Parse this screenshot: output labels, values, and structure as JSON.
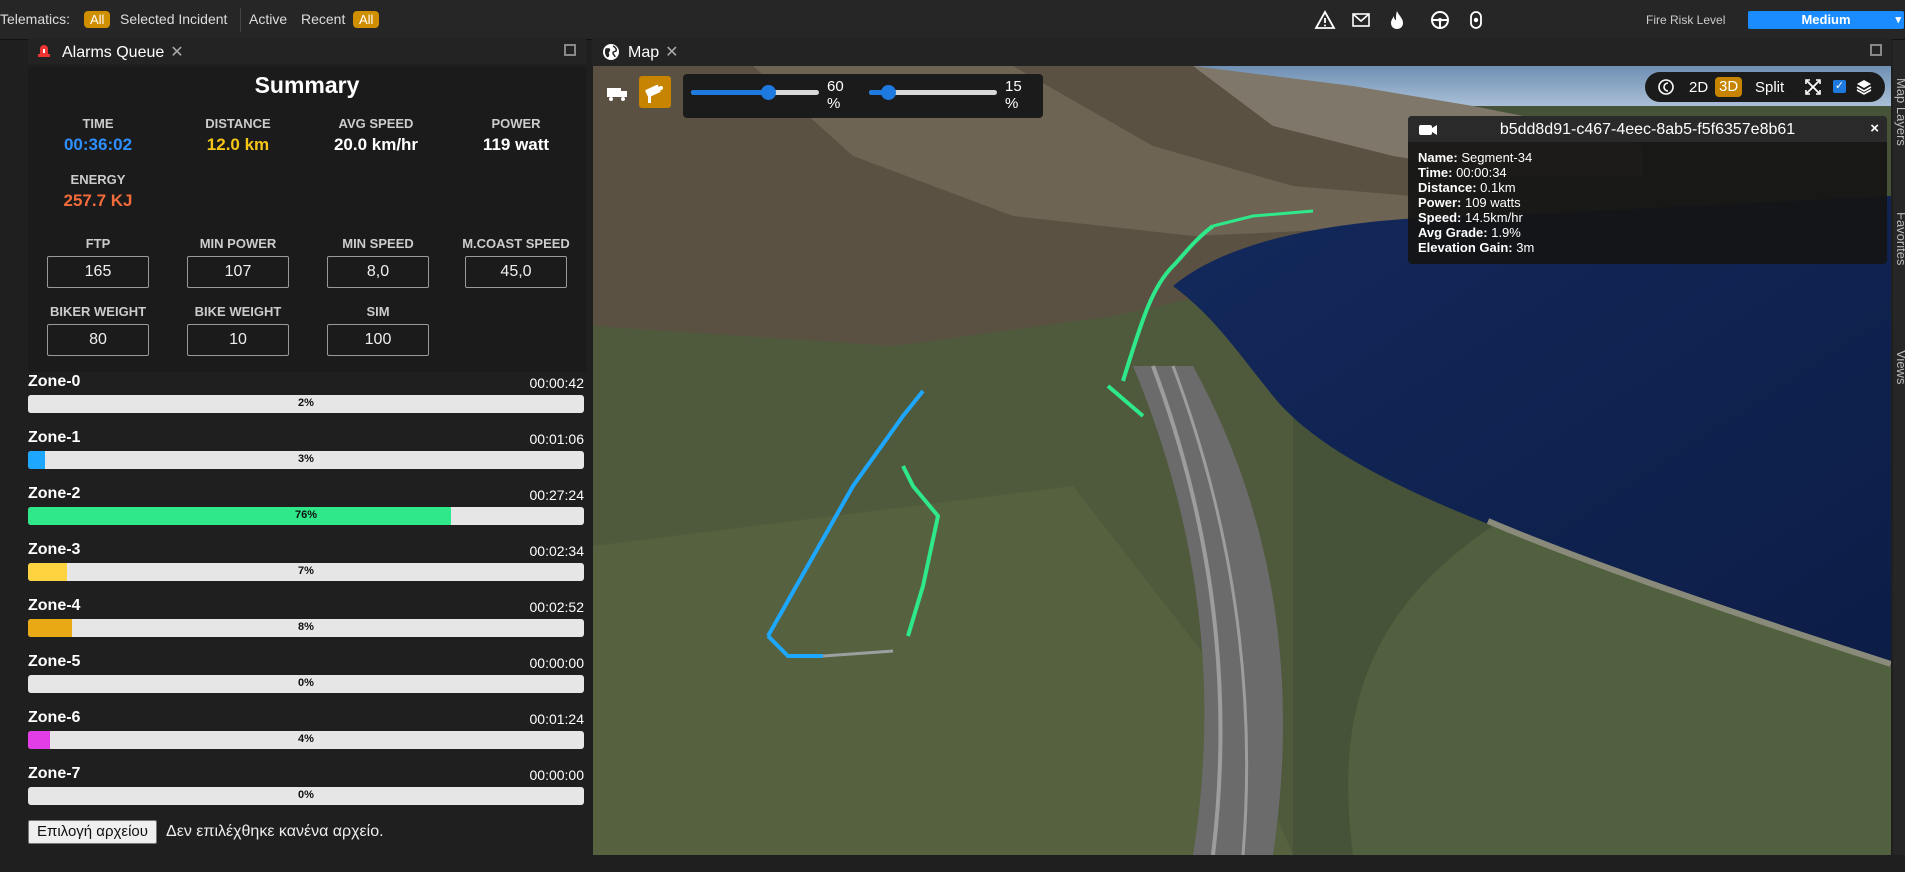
{
  "topbar": {
    "telematics_label": "Telematics:",
    "all_1": "All",
    "selected_incident": "Selected Incident",
    "active": "Active",
    "recent": "Recent",
    "all_2": "All",
    "icons": [
      "warning-icon",
      "mail-icon",
      "fire-icon",
      "steering-wheel-icon",
      "sensor-icon"
    ],
    "fire_risk_label": "Fire Risk Level",
    "fire_risk_value": "Medium"
  },
  "alarms_tab": {
    "label": "Alarms Queue"
  },
  "summary": {
    "title": "Summary",
    "stats": [
      {
        "label": "TIME",
        "value": "00:36:02",
        "color": "#2e8fff"
      },
      {
        "label": "DISTANCE",
        "value": "12.0 km",
        "color": "#f5c518"
      },
      {
        "label": "AVG SPEED",
        "value": "20.0 km/hr",
        "color": "#ffffff"
      },
      {
        "label": "POWER",
        "value": "119 watt",
        "color": "#ffffff"
      },
      {
        "label": "ENERGY",
        "value": "257.7 KJ",
        "color": "#f26b3a"
      }
    ],
    "params": [
      {
        "label": "FTP",
        "value": "165"
      },
      {
        "label": "MIN POWER",
        "value": "107"
      },
      {
        "label": "MIN SPEED",
        "value": "8,0"
      },
      {
        "label": "M.COAST SPEED",
        "value": "45,0"
      },
      {
        "label": "BIKER WEIGHT",
        "value": "80"
      },
      {
        "label": "BIKE WEIGHT",
        "value": "10"
      },
      {
        "label": "SIM",
        "value": "100"
      }
    ]
  },
  "zones": [
    {
      "name": "Zone-0",
      "time": "00:00:42",
      "percent": 2,
      "label": "2%",
      "color": "#e6e6e6"
    },
    {
      "name": "Zone-1",
      "time": "00:01:06",
      "percent": 3,
      "label": "3%",
      "color": "#1ea7ff"
    },
    {
      "name": "Zone-2",
      "time": "00:27:24",
      "percent": 76,
      "label": "76%",
      "color": "#2ee88a"
    },
    {
      "name": "Zone-3",
      "time": "00:02:34",
      "percent": 7,
      "label": "7%",
      "color": "#ffd23f"
    },
    {
      "name": "Zone-4",
      "time": "00:02:52",
      "percent": 8,
      "label": "8%",
      "color": "#e8a915"
    },
    {
      "name": "Zone-5",
      "time": "00:00:00",
      "percent": 0,
      "label": "0%",
      "color": "#e6e6e6"
    },
    {
      "name": "Zone-6",
      "time": "00:01:24",
      "percent": 4,
      "label": "4%",
      "color": "#e33de8"
    },
    {
      "name": "Zone-7",
      "time": "00:00:00",
      "percent": 0,
      "label": "0%",
      "color": "#e6e6e6"
    }
  ],
  "file_input": {
    "button": "Επιλογή αρχείου",
    "status": "Δεν επιλέχθηκε κανένα αρχείο."
  },
  "map_tab": {
    "label": "Map"
  },
  "map": {
    "slider_1": {
      "value": 60,
      "label": "60",
      "unit": "%"
    },
    "slider_2": {
      "value": 15,
      "label": "15",
      "unit": "%"
    },
    "view_modes": {
      "mode_2d": "2D",
      "mode_3d": "3D",
      "split": "Split"
    },
    "popup": {
      "title": "b5dd8d91-c467-4eec-8ab5-f5f6357e8b61",
      "close": "×",
      "rows": [
        {
          "key": "Name:",
          "value": "Segment-34"
        },
        {
          "key": "Time:",
          "value": "00:00:34"
        },
        {
          "key": "Distance:",
          "value": "0.1km"
        },
        {
          "key": "Power:",
          "value": "109 watts"
        },
        {
          "key": "Speed:",
          "value": "14.5km/hr"
        },
        {
          "key": "Avg Grade:",
          "value": "1.9%"
        },
        {
          "key": "Elevation Gain:",
          "value": "3m"
        }
      ]
    },
    "side_tabs": [
      "Map Layers",
      "Favorites",
      "Views"
    ]
  }
}
